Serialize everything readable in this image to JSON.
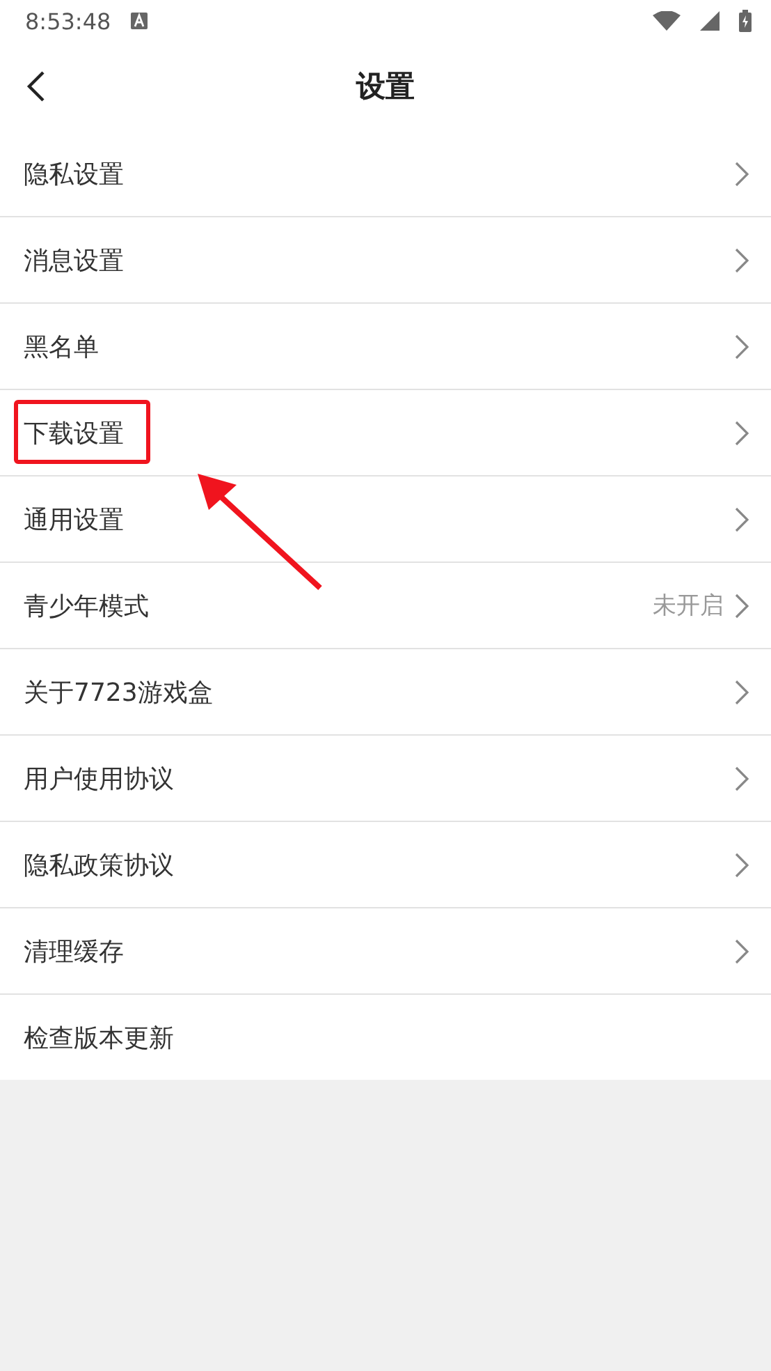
{
  "status_bar": {
    "time": "8:53:48"
  },
  "header": {
    "title": "设置"
  },
  "items": [
    {
      "label": "隐私设置",
      "chevron": true,
      "highlighted": false
    },
    {
      "label": "消息设置",
      "chevron": true,
      "highlighted": false
    },
    {
      "label": "黑名单",
      "chevron": true,
      "highlighted": false
    },
    {
      "label": "下载设置",
      "chevron": true,
      "highlighted": true
    },
    {
      "label": "通用设置",
      "chevron": true,
      "highlighted": false
    },
    {
      "label": "青少年模式",
      "value": "未开启",
      "chevron": true,
      "highlighted": false
    },
    {
      "label": "关于7723游戏盒",
      "chevron": true,
      "highlighted": false
    },
    {
      "label": "用户使用协议",
      "chevron": true,
      "highlighted": false
    },
    {
      "label": "隐私政策协议",
      "chevron": true,
      "highlighted": false
    },
    {
      "label": "清理缓存",
      "chevron": true,
      "highlighted": false
    },
    {
      "label": "检查版本更新",
      "chevron": false,
      "highlighted": false
    }
  ]
}
